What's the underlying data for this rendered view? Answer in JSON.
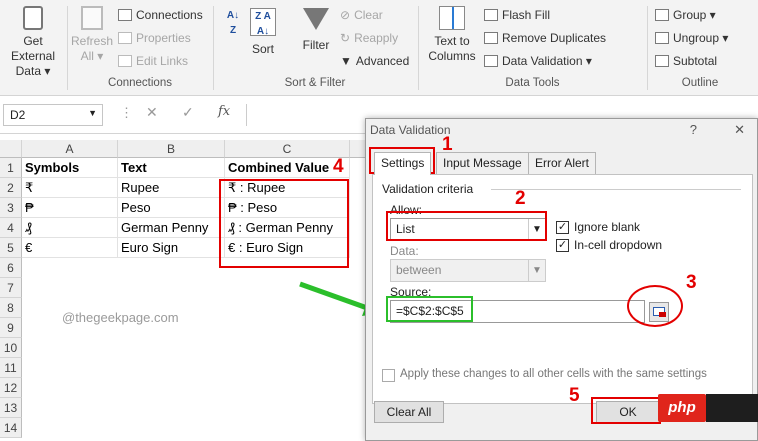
{
  "ribbon": {
    "get_external_data": "Get External Data ▾",
    "refresh_all": "Refresh All ▾",
    "connections": "Connections",
    "properties": "Properties",
    "edit_links": "Edit Links",
    "grp_connections": "Connections",
    "sort": "Sort",
    "filter": "Filter",
    "clear": "Clear",
    "reapply": "Reapply",
    "advanced": "Advanced",
    "grp_sort_filter": "Sort & Filter",
    "text_to_columns": "Text to Columns",
    "flash_fill": "Flash Fill",
    "remove_duplicates": "Remove Duplicates",
    "data_validation": "Data Validation ▾",
    "grp_data_tools": "Data Tools",
    "group": "Group ▾",
    "ungroup": "Ungroup ▾",
    "subtotal": "Subtotal",
    "grp_outline": "Outline",
    "icons": {
      "get_data": "database-icon",
      "refresh": "refresh-icon",
      "sort_az": "sort-az-icon",
      "filter": "funnel-icon",
      "text_to_columns": "text-columns-icon"
    }
  },
  "formula_bar": {
    "name_box": "D2",
    "fx": "fx"
  },
  "grid": {
    "columns": [
      "A",
      "B",
      "C"
    ],
    "rows": [
      "1",
      "2",
      "3",
      "4",
      "5",
      "6",
      "7",
      "8",
      "9",
      "10",
      "11",
      "12",
      "13",
      "14"
    ],
    "header_row": [
      "Symbols",
      "Text",
      "Combined Value"
    ],
    "data": [
      [
        "₹",
        "Rupee",
        "₹ : Rupee"
      ],
      [
        "₱",
        "Peso",
        "₱ : Peso"
      ],
      [
        "₰",
        "German Penny",
        "₰ : German Penny"
      ],
      [
        "€",
        "Euro Sign",
        "€ : Euro Sign"
      ]
    ],
    "watermark": "@thegeekpage.com"
  },
  "dialog": {
    "title": "Data Validation",
    "help": "?",
    "close": "✕",
    "tabs": [
      "Settings",
      "Input Message",
      "Error Alert"
    ],
    "validation_criteria": "Validation criteria",
    "allow_label": "Allow:",
    "allow_value": "List",
    "ignore_blank": "Ignore blank",
    "in_cell_dropdown": "In-cell dropdown",
    "data_label": "Data:",
    "data_value": "between",
    "source_label": "Source:",
    "source_value": "=$C$2:$C$5",
    "apply_all": "Apply these changes to all other cells with the same settings",
    "clear_all": "Clear All",
    "ok": "OK"
  },
  "annotations": [
    "1",
    "2",
    "3",
    "4",
    "5"
  ],
  "badge": {
    "php": "php",
    "colors": {
      "annotation": "#e30000",
      "arrow": "#2bbf2b"
    }
  }
}
